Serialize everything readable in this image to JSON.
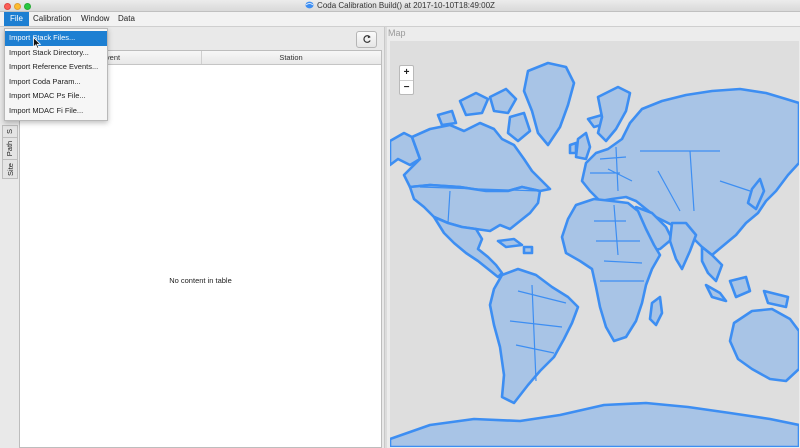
{
  "window": {
    "title": "Coda Calibration Build() at 2017-10-10T18:49:00Z"
  },
  "menubar": {
    "items": [
      "File",
      "Calibration",
      "Window",
      "Data"
    ],
    "active": "File"
  },
  "file_menu": {
    "items": [
      "Import Stack Files...",
      "Import Stack Directory...",
      "Import Reference Events...",
      "Import Coda Param...",
      "Import MDAC Ps File...",
      "Import MDAC Fi File..."
    ],
    "highlighted_index": 0
  },
  "left_pane": {
    "refresh_icon": "refresh-icon",
    "vertical_tabs": [
      "S",
      "Path",
      "Site"
    ],
    "table": {
      "columns": [
        "Event",
        "Station"
      ],
      "empty_message": "No content in table"
    }
  },
  "map": {
    "label": "Map",
    "zoom_in": "+",
    "zoom_out": "−",
    "land_color": "#a8c4e6",
    "coast_color": "#3d8ef2",
    "background_color": "#dedede"
  }
}
